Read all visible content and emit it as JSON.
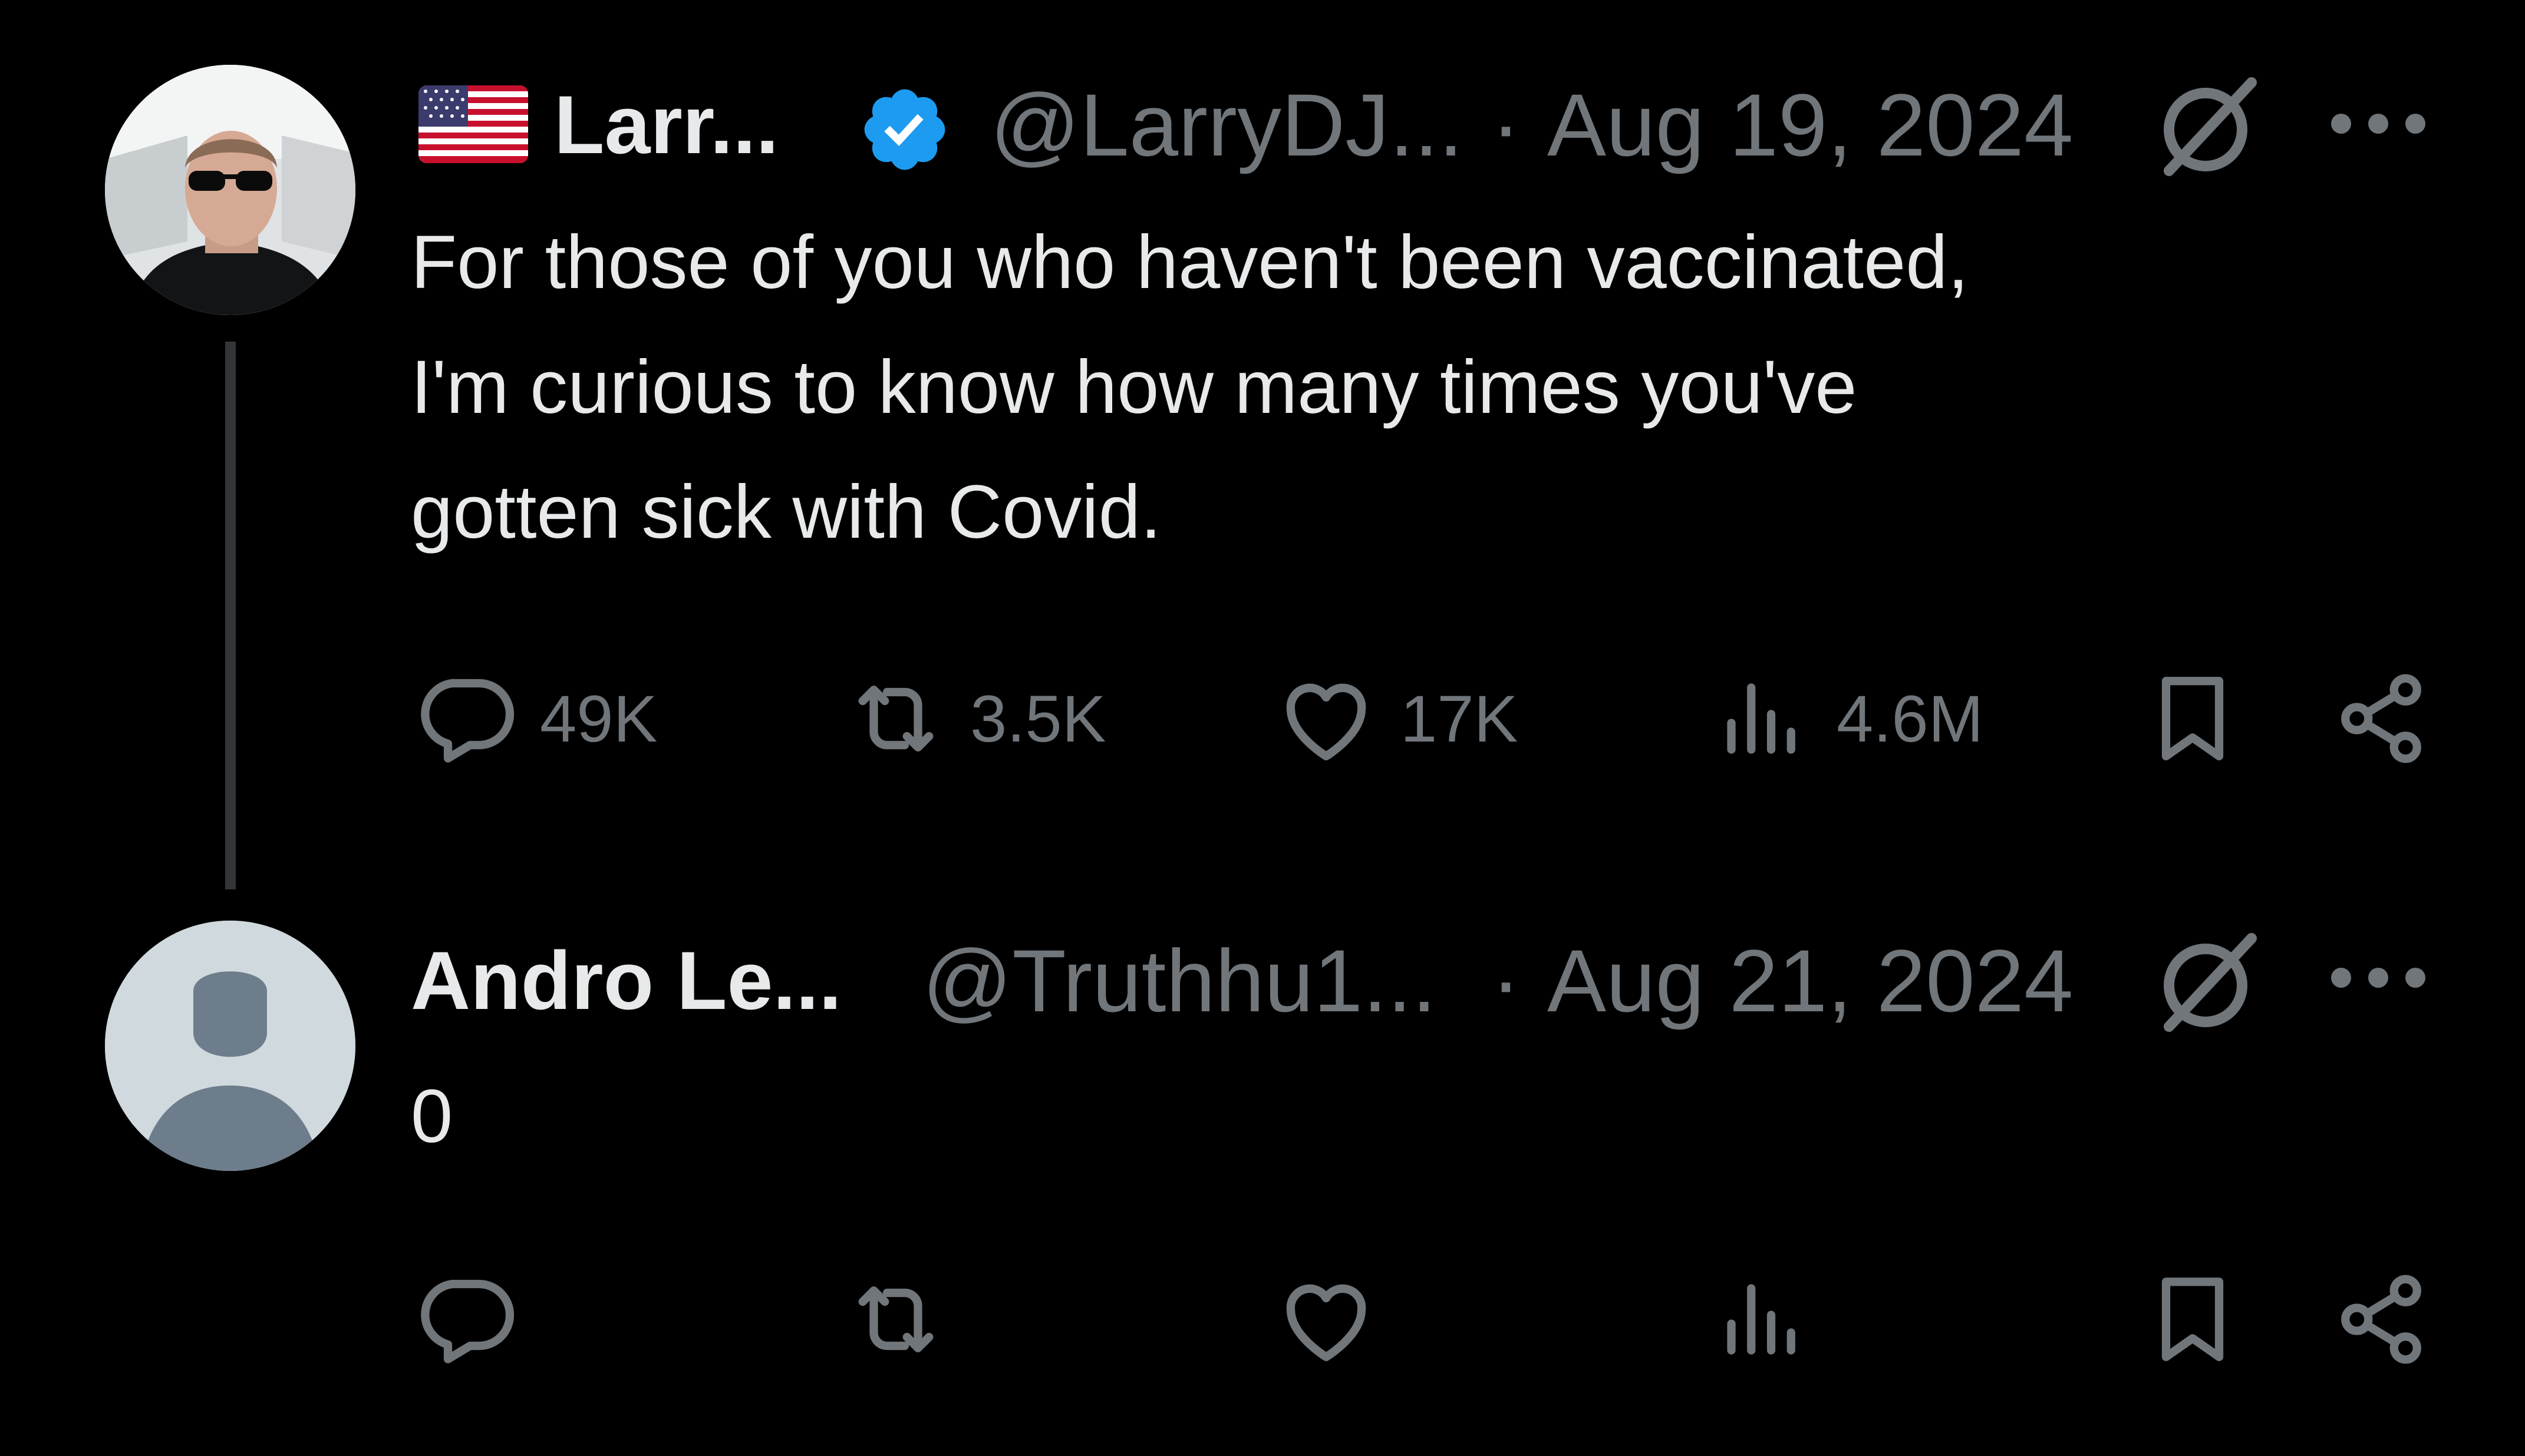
{
  "tweets": [
    {
      "author_name": "Larr...",
      "handle": "@LarryDJ...",
      "separator": "·",
      "date": "Aug 19, 2024",
      "verified": true,
      "flag": "us-flag-icon",
      "text_lines": [
        "For those of you who haven't been vaccinated,",
        "I'm curious to know how many times you've",
        "gotten sick with Covid."
      ],
      "stats": {
        "replies": "49K",
        "reposts": "3.5K",
        "likes": "17K",
        "views": "4.6M"
      }
    },
    {
      "author_name": "Andro Le...",
      "handle": "@Truthhu1...",
      "separator": "·",
      "date": "Aug 21, 2024",
      "verified": false,
      "text_lines": [
        "0"
      ],
      "stats": {
        "replies": "",
        "reposts": "",
        "likes": "",
        "views": ""
      }
    }
  ],
  "icons": [
    "reply-icon",
    "repost-icon",
    "like-icon",
    "views-icon",
    "bookmark-icon",
    "share-icon",
    "grok-icon",
    "more-icon",
    "verified-badge-icon",
    "default-avatar-icon"
  ],
  "colors": {
    "background": "#000000",
    "text": "#e7e9ea",
    "muted": "#71767b",
    "verified": "#1d9bf0",
    "thread_line": "#333639"
  }
}
